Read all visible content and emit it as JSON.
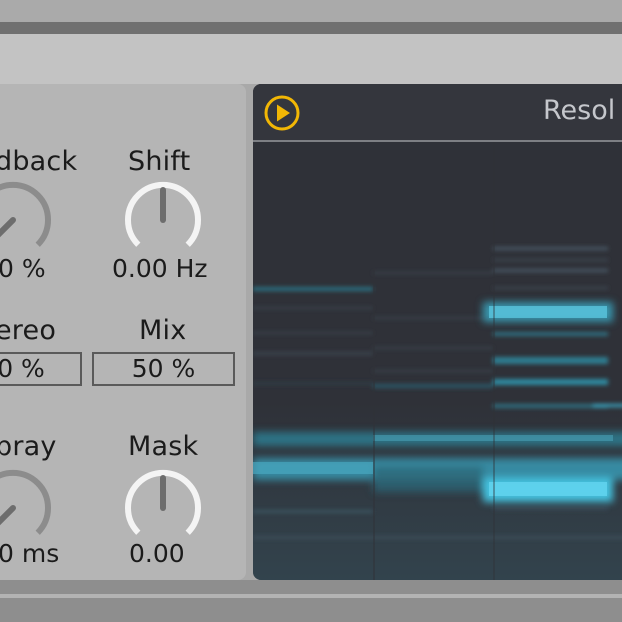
{
  "device": {
    "knobs": [
      {
        "id": "feedback",
        "label": "dback",
        "value": "0 %",
        "angle": -140,
        "style": "left"
      },
      {
        "id": "shift",
        "label": "Shift",
        "value": "0.00 Hz",
        "angle": 0,
        "style": "center"
      },
      {
        "id": "spray",
        "label": "pray",
        "value": "0 ms",
        "angle": -140,
        "style": "left"
      },
      {
        "id": "mask",
        "label": "Mask",
        "value": "0.00",
        "angle": 0,
        "style": "center"
      }
    ],
    "fields": [
      {
        "id": "stereo",
        "label": "ereo",
        "value": "0 %"
      },
      {
        "id": "mix",
        "label": "Mix",
        "value": "50 %"
      }
    ]
  },
  "display": {
    "title": "Resol",
    "play_icon": "play-icon",
    "accent": "#f2b705",
    "spectrum_color": "#4fc7e6"
  }
}
